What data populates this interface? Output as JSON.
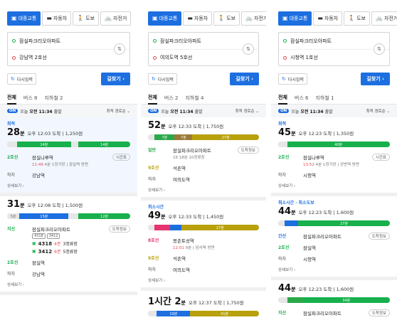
{
  "panels": [
    {
      "tabs": [
        "대중교통",
        "자동차",
        "도보",
        "자전거"
      ],
      "origin": "잠실파크리오아파트",
      "dest": "강남역 2호선",
      "reset": "다시입력",
      "go": "길찾기 ›",
      "mtabs": [
        "전체",
        "버스 8",
        "지하철 2"
      ],
      "time": {
        "on": "ON",
        "pre": "오늘",
        "strong": "오전 11:34",
        "post": "출발",
        "sort": "최적 경로순 ⌄"
      },
      "routes": [
        {
          "label": "최적",
          "mins": "28",
          "unit": "분",
          "meta": "오후 12:03 도착  |  1,250원",
          "segs": [
            {
              "c": "walk",
              "w": 8,
              "t": ""
            },
            {
              "c": "#18b04c",
              "w": 44,
              "t": "14분"
            },
            {
              "c": "walk",
              "w": 6,
              "t": ""
            },
            {
              "c": "#18b04c",
              "w": 42,
              "t": "14분"
            }
          ],
          "steps": [
            {
              "line": "2호선",
              "color": "#18b04c",
              "stop": "잠실나루역",
              "sub1": "11:49",
              "sub2": " 4분 1정거장 | 잠실역 방면",
              "tag": "시간표"
            },
            {
              "line": "하차",
              "color": "#888",
              "stop": "강남역"
            }
          ],
          "more": "상세보기 ›"
        },
        {
          "label": "",
          "mins": "31",
          "unit": "분",
          "meta": "오후 12:08 도착  |  1,500원",
          "segs": [
            {
              "c": "walk",
              "w": 10,
              "t": "5분"
            },
            {
              "c": "#1d6fe0",
              "w": 40,
              "t": "15분"
            },
            {
              "c": "walk",
              "w": 8,
              "t": ""
            },
            {
              "c": "#18b04c",
              "w": 42,
              "t": "12분"
            }
          ],
          "steps": [
            {
              "line": "지선",
              "color": "#18b04c",
              "stop": "잠실파크리오아파트",
              "chips": [
                "4318",
                "3412"
              ],
              "buses": [
                {
                  "n": "4318",
                  "t": "4분",
                  "s": "3정류장"
                },
                {
                  "n": "3412",
                  "t": "6분",
                  "s": "5정류장"
                }
              ],
              "tag": "도착정보"
            },
            {
              "line": "2호선",
              "color": "#18b04c",
              "stop": "잠실역"
            },
            {
              "line": "하차",
              "color": "#888",
              "stop": "강남역"
            }
          ],
          "more": "상세보기 ›"
        }
      ]
    },
    {
      "tabs": [
        "대중교통",
        "자동차",
        "도보",
        "자전거"
      ],
      "origin": "잠실파크리오아파트",
      "dest": "여의도역 5호선",
      "reset": "다시입력",
      "go": "길찾기 ›",
      "mtabs": [
        "전체",
        "버스 2",
        "지하철 4"
      ],
      "time": {
        "on": "ON",
        "pre": "오늘",
        "strong": "오전 11:34",
        "post": "출발",
        "sort": "최적 경로순 ⌄"
      },
      "routes": [
        {
          "label": "",
          "mins": "52",
          "unit": "분",
          "meta": "오후 12:33 도착  |  1,750원",
          "segs": [
            {
              "c": "walk",
              "w": 6,
              "t": ""
            },
            {
              "c": "#2aa84a",
              "w": 18,
              "t": "7분"
            },
            {
              "c": "#9a7a38",
              "w": 16,
              "t": "7분"
            },
            {
              "c": "#b8a10c",
              "w": 60,
              "t": "27분"
            }
          ],
          "steps": [
            {
              "line": "일반",
              "color": "#2aa84a",
              "stop": "잠실파크리오아파트",
              "sub1": "",
              "sub2": "16  18분 10정류장",
              "tag": "도착정보"
            },
            {
              "line": "9호선",
              "color": "#b8a10c",
              "stop": "석촌역"
            },
            {
              "line": "하차",
              "color": "#888",
              "stop": "여의도역"
            }
          ],
          "more": "상세보기 ›"
        },
        {
          "label": "최소시간",
          "mins": "49",
          "unit": "분",
          "meta": "오후 12:33 도착  |  1,450원",
          "segs": [
            {
              "c": "walk",
              "w": 6,
              "t": ""
            },
            {
              "c": "#e6346d",
              "w": 14,
              "t": ""
            },
            {
              "c": "#1d6fe0",
              "w": 10,
              "t": ""
            },
            {
              "c": "#b8a10c",
              "w": 70,
              "t": "27분"
            }
          ],
          "steps": [
            {
              "line": "8호선",
              "color": "#e6346d",
              "stop": "몽촌토성역",
              "sub1": "12:01",
              "sub2": " 9분 | 암사역 방면",
              "tag": ""
            },
            {
              "line": "9호선",
              "color": "#b8a10c",
              "stop": "석촌역"
            },
            {
              "line": "하차",
              "color": "#888",
              "stop": "여의도역"
            }
          ],
          "more": "상세보기 ›"
        },
        {
          "label": "",
          "mins": "1시간 2",
          "unit": "분",
          "meta": "오후 12:37 도착  |  1,750원",
          "segs": [
            {
              "c": "walk",
              "w": 8,
              "t": ""
            },
            {
              "c": "#1d6fe0",
              "w": 30,
              "t": "19분"
            },
            {
              "c": "#b8a10c",
              "w": 62,
              "t": "41분"
            }
          ],
          "steps": [],
          "more": ""
        }
      ]
    },
    {
      "tabs": [
        "대중교통",
        "자동차",
        "도보",
        "자전거"
      ],
      "origin": "잠실파크리오아파트",
      "dest": "시청역 1호선",
      "reset": "다시입력",
      "go": "길찾기 ›",
      "mtabs": [
        "전체",
        "버스 6",
        "지하철 1"
      ],
      "time": {
        "on": "ON",
        "pre": "오늘",
        "strong": "오전 11:34",
        "post": "출발",
        "sort": "최적 경로순 ⌄"
      },
      "routes": [
        {
          "label": "최적",
          "mins": "45",
          "unit": "분",
          "meta": "오후 12:23 도착  |  1,350원",
          "segs": [
            {
              "c": "walk",
              "w": 8,
              "t": ""
            },
            {
              "c": "#18b04c",
              "w": 92,
              "t": "40분"
            }
          ],
          "steps": [
            {
              "line": "2호선",
              "color": "#18b04c",
              "stop": "잠실나루역",
              "sub1": "13:52",
              "sub2": " 4분 1정거장 | 강변역 방면",
              "tag": "시간표"
            },
            {
              "line": "하차",
              "color": "#888",
              "stop": "시청역"
            }
          ],
          "more": "상세보기 ›"
        },
        {
          "label": "최소시간 · 최소도보",
          "mins": "44",
          "unit": "분",
          "meta": "오후 12:23 도착  |  1,600원",
          "segs": [
            {
              "c": "walk",
              "w": 6,
              "t": ""
            },
            {
              "c": "#1d6fe0",
              "w": 12,
              "t": ""
            },
            {
              "c": "#18b04c",
              "w": 82,
              "t": "27분"
            }
          ],
          "steps": [
            {
              "line": "간선",
              "color": "#1d6fe0",
              "stop": "잠실파크리오아파트",
              "tag": "도착정보"
            },
            {
              "line": "2호선",
              "color": "#18b04c",
              "stop": "잠실역"
            },
            {
              "line": "하차",
              "color": "#888",
              "stop": "시청역"
            }
          ],
          "more": "상세보기 ›"
        },
        {
          "label": "",
          "mins": "44",
          "unit": "분",
          "meta": "오후 12:23 도착  |  1,600원",
          "segs": [
            {
              "c": "walk",
              "w": 8,
              "t": ""
            },
            {
              "c": "#2aa84a",
              "w": 14,
              "t": ""
            },
            {
              "c": "#18b04c",
              "w": 78,
              "t": "34분"
            }
          ],
          "steps": [
            {
              "line": "지선",
              "color": "#2aa84a",
              "stop": "잠실파크리오아파트",
              "tag": "도착정보"
            }
          ],
          "more": ""
        }
      ]
    }
  ]
}
